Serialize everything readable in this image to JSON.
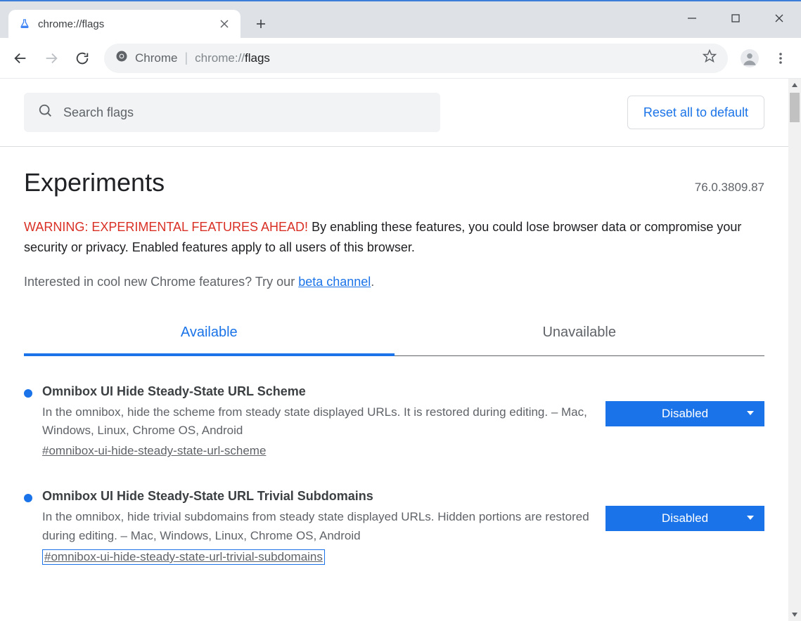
{
  "window": {
    "tab_title": "chrome://flags"
  },
  "omnibox": {
    "origin_label": "Chrome",
    "url_gray": "chrome://",
    "url_dark": "flags"
  },
  "search": {
    "placeholder": "Search flags",
    "reset": "Reset all to default"
  },
  "main": {
    "title": "Experiments",
    "version": "76.0.3809.87",
    "warning_prefix": "WARNING: EXPERIMENTAL FEATURES AHEAD!",
    "warning_body": " By enabling these features, you could lose browser data or compromise your security or privacy. Enabled features apply to all users of this browser.",
    "beta_prefix": "Interested in cool new Chrome features? Try our ",
    "beta_link": "beta channel",
    "beta_suffix": "."
  },
  "tabs": {
    "available": "Available",
    "unavailable": "Unavailable"
  },
  "flags": [
    {
      "title": "Omnibox UI Hide Steady-State URL Scheme",
      "desc": "In the omnibox, hide the scheme from steady state displayed URLs. It is restored during editing. – Mac, Windows, Linux, Chrome OS, Android",
      "anchor": "#omnibox-ui-hide-steady-state-url-scheme",
      "value": "Disabled"
    },
    {
      "title": "Omnibox UI Hide Steady-State URL Trivial Subdomains",
      "desc": "In the omnibox, hide trivial subdomains from steady state displayed URLs. Hidden portions are restored during editing. – Mac, Windows, Linux, Chrome OS, Android",
      "anchor": "#omnibox-ui-hide-steady-state-url-trivial-subdomains",
      "value": "Disabled"
    }
  ]
}
